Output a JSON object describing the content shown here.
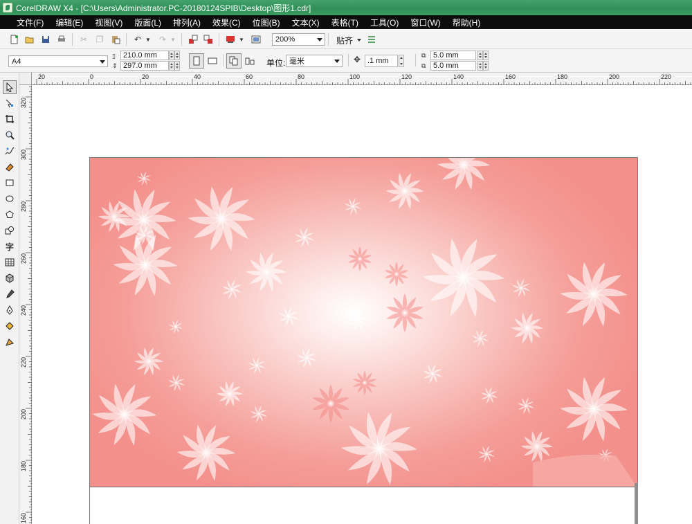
{
  "window": {
    "title": "CorelDRAW X4 - [C:\\Users\\Administrator.PC-20180124SPIB\\Desktop\\图形1.cdr]"
  },
  "menu": [
    "文件(F)",
    "编辑(E)",
    "视图(V)",
    "版面(L)",
    "排列(A)",
    "效果(C)",
    "位图(B)",
    "文本(X)",
    "表格(T)",
    "工具(O)",
    "窗口(W)",
    "帮助(H)"
  ],
  "standard_toolbar": {
    "icons": [
      "new-document-icon",
      "open-icon",
      "save-icon",
      "print-icon",
      "cut-icon",
      "copy-icon",
      "paste-icon",
      "undo-icon",
      "redo-icon",
      "import-icon",
      "export-icon",
      "application-launcher-icon",
      "welcome-screen-icon"
    ],
    "zoom_level": "200%",
    "snap_label": "贴齐"
  },
  "property_bar": {
    "paper_size": "A4",
    "page_width": "210.0 mm",
    "page_height": "297.0 mm",
    "units_label": "单位:",
    "units_value": "毫米",
    "nudge_distance": ".1 mm",
    "duplicate_x": "5.0 mm",
    "duplicate_y": "5.0 mm"
  },
  "rulers": {
    "horizontal_labels": [
      "20",
      "0",
      "20",
      "40",
      "60",
      "80",
      "100",
      "120",
      "140",
      "160",
      "180",
      "200",
      "220"
    ],
    "vertical_labels": [
      "320",
      "300",
      "280",
      "260",
      "240",
      "220",
      "200",
      "180",
      "160"
    ]
  },
  "toolbox": [
    "pick-tool-icon",
    "shape-tool-icon",
    "crop-tool-icon",
    "zoom-tool-icon",
    "freehand-tool-icon",
    "smart-fill-tool-icon",
    "rectangle-tool-icon",
    "ellipse-tool-icon",
    "polygon-tool-icon",
    "basic-shapes-tool-icon",
    "text-tool-icon",
    "table-tool-icon",
    "interactive-effects-tool-icon",
    "eyedropper-tool-icon",
    "outline-tool-icon",
    "fill-tool-icon",
    "interactive-fill-tool-icon"
  ],
  "colors": {
    "title_bar": "#2f8f56",
    "menu_bar": "#0d0d0d",
    "artwork_edge": "#f3908b",
    "artwork_center": "#ffffff"
  }
}
